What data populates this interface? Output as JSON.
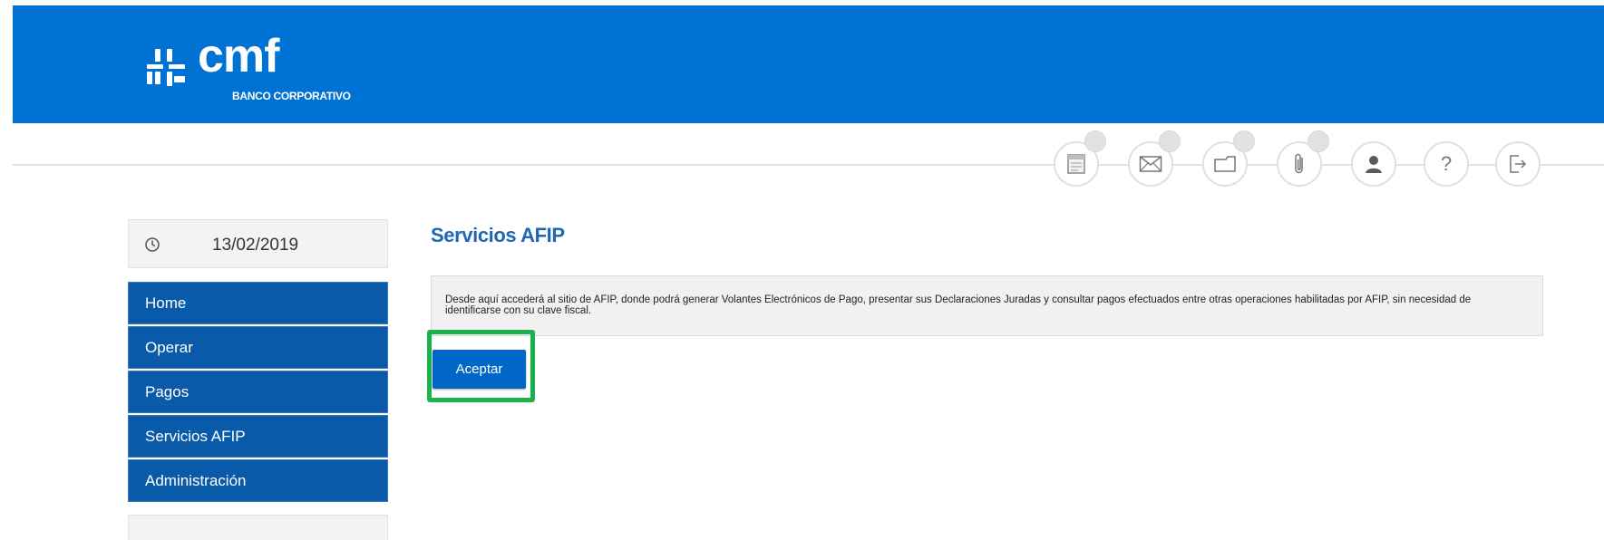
{
  "header": {
    "brand_name": "cmf",
    "brand_subtitle": "BANCO CORPORATIVO",
    "background_color": "#0072d3"
  },
  "toolbar": {
    "icons": [
      "calendar-icon",
      "mail-icon",
      "folder-icon",
      "attachment-icon",
      "user-icon",
      "help-icon",
      "logout-icon"
    ],
    "help_label": "?"
  },
  "sidebar": {
    "date": "13/02/2019",
    "items": [
      {
        "label": "Home"
      },
      {
        "label": "Operar"
      },
      {
        "label": "Pagos"
      },
      {
        "label": "Servicios AFIP"
      },
      {
        "label": "Administración"
      }
    ],
    "item_color": "#0a5aaa"
  },
  "main": {
    "title": "Servicios AFIP",
    "description": "Desde aquí accederá al sitio de AFIP, donde podrá generar Volantes Electrónicos de Pago, presentar sus Declaraciones Juradas y consultar pagos efectuados entre otras operaciones habilitadas por AFIP, sin necesidad de identificarse con su clave fiscal.",
    "accept_label": "Aceptar",
    "highlight_color": "#19b24b"
  }
}
